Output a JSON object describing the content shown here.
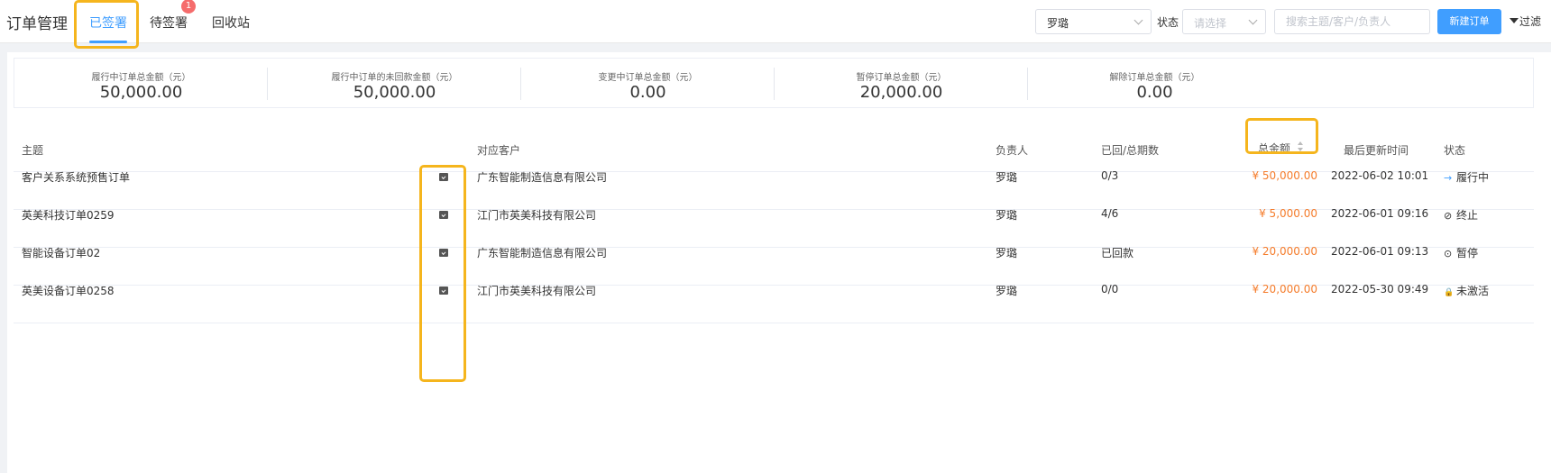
{
  "header": {
    "title": "订单管理",
    "tabs": [
      {
        "label": "已签署",
        "active": true
      },
      {
        "label": "待签署",
        "badge": "1"
      },
      {
        "label": "回收站"
      }
    ],
    "owner_select": {
      "value": "罗璐"
    },
    "status_label": "状态",
    "status_select": {
      "placeholder": "请选择"
    },
    "search": {
      "placeholder": "搜索主题/客户/负责人",
      "value": ""
    },
    "new_order_label": "新建订单",
    "filter_label": "过滤"
  },
  "stats": [
    {
      "label": "履行中订单总金额（元）",
      "value": "50,000.00"
    },
    {
      "label": "履行中订单的未回款金额（元）",
      "value": "50,000.00"
    },
    {
      "label": "变更中订单总金额（元）",
      "value": "0.00"
    },
    {
      "label": "暂停订单总金额（元）",
      "value": "20,000.00"
    },
    {
      "label": "解除订单总金额（元）",
      "value": "0.00"
    }
  ],
  "table": {
    "columns": [
      "主题",
      "对应客户",
      "负责人",
      "已回/总期数",
      "总金额",
      "最后更新时间",
      "状态"
    ],
    "rows": [
      {
        "subject": "客户关系系统预售订单",
        "customer": "广东智能制造信息有限公司",
        "owner": "罗璐",
        "periods": "0/3",
        "amount": "¥ 50,000.00",
        "updated": "2022-06-02 10:01",
        "status_icon": "→",
        "status": "履行中"
      },
      {
        "subject": "英美科技订单0259",
        "customer": "江门市英美科技有限公司",
        "owner": "罗璐",
        "periods": "4/6",
        "amount": "¥ 5,000.00",
        "updated": "2022-06-01 09:16",
        "status_icon": "⊘",
        "status": "终止"
      },
      {
        "subject": "智能设备订单02",
        "customer": "广东智能制造信息有限公司",
        "owner": "罗璐",
        "periods": "已回款",
        "amount": "¥ 20,000.00",
        "updated": "2022-06-01 09:13",
        "status_icon": "⊙",
        "status": "暂停"
      },
      {
        "subject": "英美设备订单0258",
        "customer": "江门市英美科技有限公司",
        "owner": "罗璐",
        "periods": "0/0",
        "amount": "¥ 20,000.00",
        "updated": "2022-05-30 09:49",
        "status_icon": "🔒",
        "status": "未激活"
      }
    ]
  },
  "colors": {
    "accent": "#409eff",
    "amount": "#f57c2b",
    "highlight": "#f5b51d",
    "badge": "#f56c6c"
  }
}
